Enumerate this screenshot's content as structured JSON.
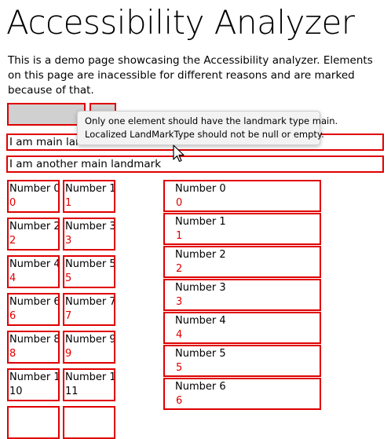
{
  "page": {
    "title": "Accessibility Analyzer",
    "description": "This is a demo page showcasing the Accessibility analyzer. Elements on this page are inacessible for different reasons and are marked because of that."
  },
  "landmarks": [
    {
      "label": "I am main landmark"
    },
    {
      "label": "I am another main landmark"
    }
  ],
  "tooltip": {
    "line1": "Only one element should have the landmark type main.",
    "line2": "Localized LandMarkType should not be null or empty."
  },
  "grid": [
    {
      "label": "Number 0",
      "value": "0"
    },
    {
      "label": "Number 1",
      "value": "1"
    },
    {
      "label": "Number 2",
      "value": "2"
    },
    {
      "label": "Number 3",
      "value": "3"
    },
    {
      "label": "Number 4",
      "value": "4"
    },
    {
      "label": "Number 5",
      "value": "5"
    },
    {
      "label": "Number 6",
      "value": "6"
    },
    {
      "label": "Number 7",
      "value": "7"
    },
    {
      "label": "Number 8",
      "value": "8"
    },
    {
      "label": "Number 9",
      "value": "9"
    },
    {
      "label": "Number 1",
      "value": "10"
    },
    {
      "label": "Number 1",
      "value": "11"
    }
  ],
  "list": [
    {
      "label": "Number 0",
      "value": "0"
    },
    {
      "label": "Number 1",
      "value": "1"
    },
    {
      "label": "Number 2",
      "value": "2"
    },
    {
      "label": "Number 3",
      "value": "3"
    },
    {
      "label": "Number 4",
      "value": "4"
    },
    {
      "label": "Number 5",
      "value": "5"
    },
    {
      "label": "Number 6",
      "value": "6"
    }
  ],
  "colors": {
    "error_border": "#e00000",
    "button_fill": "#d0d0d0",
    "tooltip_bg": "#f3f3f3"
  },
  "icons": {
    "cursor": "mouse-pointer-icon"
  }
}
